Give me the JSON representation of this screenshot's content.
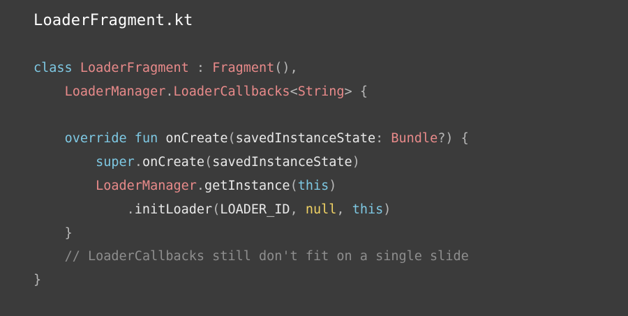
{
  "slide": {
    "title": "LoaderFragment.kt",
    "colors": {
      "background": "#3b3b3b",
      "title": "#ffffff",
      "plain": "#e8e8e8",
      "keyword": "#7ec8e3",
      "type": "#e88a8a",
      "literal": "#f0d264",
      "punctuation": "#b8b8b8",
      "comment": "#8e8e8e"
    },
    "code_lines": [
      [
        {
          "text": "class ",
          "kind": "keyword"
        },
        {
          "text": "LoaderFragment",
          "kind": "type"
        },
        {
          "text": " : ",
          "kind": "punctuation"
        },
        {
          "text": "Fragment",
          "kind": "type"
        },
        {
          "text": "(),",
          "kind": "punctuation"
        }
      ],
      [
        {
          "text": "    ",
          "kind": "plain"
        },
        {
          "text": "LoaderManager",
          "kind": "type"
        },
        {
          "text": ".",
          "kind": "punctuation"
        },
        {
          "text": "LoaderCallbacks",
          "kind": "type"
        },
        {
          "text": "<",
          "kind": "punctuation"
        },
        {
          "text": "String",
          "kind": "type"
        },
        {
          "text": "> {",
          "kind": "punctuation"
        }
      ],
      [],
      [
        {
          "text": "    ",
          "kind": "plain"
        },
        {
          "text": "override fun ",
          "kind": "keyword"
        },
        {
          "text": "onCreate",
          "kind": "plain"
        },
        {
          "text": "(",
          "kind": "punctuation"
        },
        {
          "text": "savedInstanceState",
          "kind": "plain"
        },
        {
          "text": ": ",
          "kind": "punctuation"
        },
        {
          "text": "Bundle",
          "kind": "type"
        },
        {
          "text": "?) {",
          "kind": "punctuation"
        }
      ],
      [
        {
          "text": "        ",
          "kind": "plain"
        },
        {
          "text": "super",
          "kind": "keyword"
        },
        {
          "text": ".",
          "kind": "punctuation"
        },
        {
          "text": "onCreate",
          "kind": "plain"
        },
        {
          "text": "(",
          "kind": "punctuation"
        },
        {
          "text": "savedInstanceState",
          "kind": "plain"
        },
        {
          "text": ")",
          "kind": "punctuation"
        }
      ],
      [
        {
          "text": "        ",
          "kind": "plain"
        },
        {
          "text": "LoaderManager",
          "kind": "type"
        },
        {
          "text": ".",
          "kind": "punctuation"
        },
        {
          "text": "getInstance",
          "kind": "plain"
        },
        {
          "text": "(",
          "kind": "punctuation"
        },
        {
          "text": "this",
          "kind": "keyword"
        },
        {
          "text": ")",
          "kind": "punctuation"
        }
      ],
      [
        {
          "text": "            ",
          "kind": "plain"
        },
        {
          "text": ".",
          "kind": "punctuation"
        },
        {
          "text": "initLoader",
          "kind": "plain"
        },
        {
          "text": "(",
          "kind": "punctuation"
        },
        {
          "text": "LOADER_ID",
          "kind": "plain"
        },
        {
          "text": ", ",
          "kind": "punctuation"
        },
        {
          "text": "null",
          "kind": "literal"
        },
        {
          "text": ", ",
          "kind": "punctuation"
        },
        {
          "text": "this",
          "kind": "keyword"
        },
        {
          "text": ")",
          "kind": "punctuation"
        }
      ],
      [
        {
          "text": "    ",
          "kind": "plain"
        },
        {
          "text": "}",
          "kind": "punctuation"
        }
      ],
      [
        {
          "text": "    ",
          "kind": "plain"
        },
        {
          "text": "// LoaderCallbacks still don't fit on a single slide",
          "kind": "comment"
        }
      ],
      [
        {
          "text": "}",
          "kind": "punctuation"
        }
      ]
    ]
  }
}
